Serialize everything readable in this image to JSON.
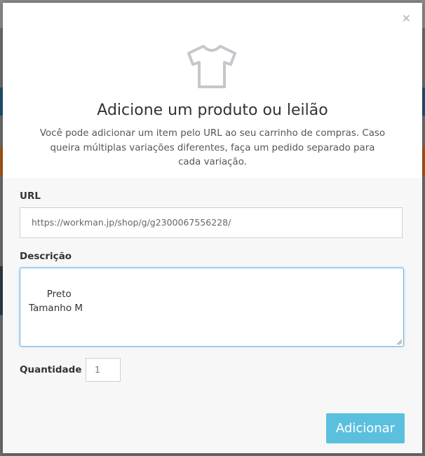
{
  "modal": {
    "close_label": "×",
    "icon": "tshirt-icon",
    "title": "Adicione um produto ou leilão",
    "subtitle": "Você pode adicionar um item pelo URL ao seu carrinho de compras. Caso queira múltiplas variações diferentes, faça um pedido separado para cada variação."
  },
  "form": {
    "url_label": "URL",
    "url_value": "https://workman.jp/shop/g/g2300067556228/",
    "description_label": "Descrição",
    "description_value": "Preto\nTamanho M",
    "quantity_label": "Quantidade",
    "quantity_value": "1",
    "submit_label": "Adicionar"
  },
  "colors": {
    "accent": "#5bc0de",
    "focus_border": "#6fb4e0",
    "icon_stroke": "#c4c8cc"
  }
}
